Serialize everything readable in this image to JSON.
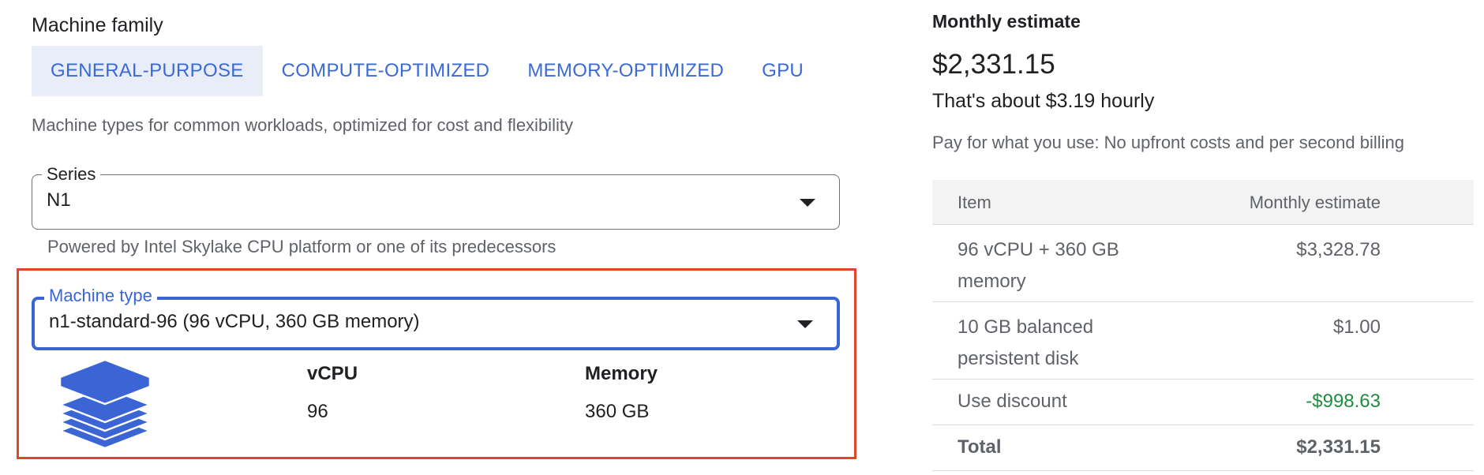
{
  "machine_family": {
    "title": "Machine family",
    "tabs": [
      {
        "label": "GENERAL-PURPOSE",
        "active": true
      },
      {
        "label": "COMPUTE-OPTIMIZED",
        "active": false
      },
      {
        "label": "MEMORY-OPTIMIZED",
        "active": false
      },
      {
        "label": "GPU",
        "active": false
      }
    ],
    "description": "Machine types for common workloads, optimized for cost and flexibility"
  },
  "series": {
    "label": "Series",
    "value": "N1",
    "hint": "Powered by Intel Skylake CPU platform or one of its predecessors"
  },
  "machine_type": {
    "label": "Machine type",
    "value": "n1-standard-96 (96 vCPU, 360 GB memory)",
    "icon": "stack-layers-icon",
    "specs": [
      {
        "label": "vCPU",
        "value": "96"
      },
      {
        "label": "Memory",
        "value": "360 GB"
      }
    ]
  },
  "estimate": {
    "title": "Monthly estimate",
    "total": "$2,331.15",
    "hourly": "That's about $3.19 hourly",
    "note": "Pay for what you use: No upfront costs and per second billing",
    "table": {
      "headers": [
        "Item",
        "Monthly estimate"
      ],
      "rows": [
        {
          "item": "96 vCPU + 360 GB memory",
          "cost": "$3,328.78"
        },
        {
          "item": "10 GB balanced persistent disk",
          "cost": "$1.00"
        },
        {
          "item": "Use discount",
          "cost": "-$998.63"
        }
      ],
      "total": {
        "item": "Total",
        "cost": "$2,331.15"
      }
    }
  },
  "colors": {
    "accent": "#3b64d4",
    "active_tab_bg": "#e8edf8",
    "highlight_border": "#e0462d",
    "discount": "#1e8e3e"
  }
}
